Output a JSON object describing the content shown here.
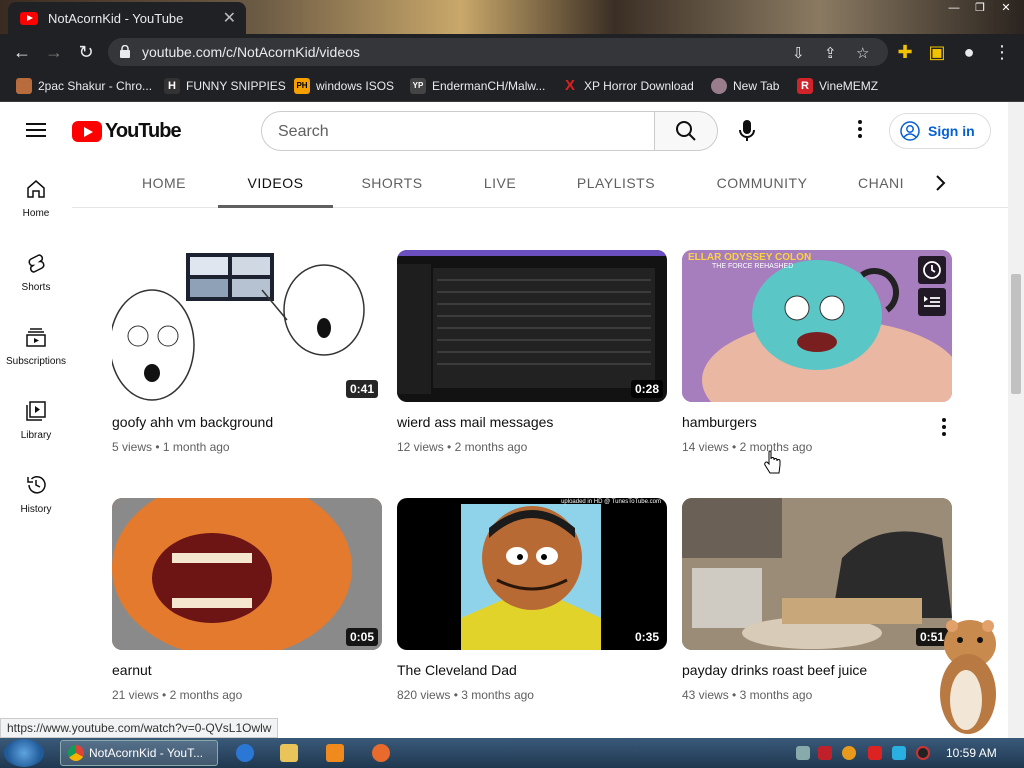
{
  "browser": {
    "tab_title": "NotAcornKid - YouTube",
    "url": "youtube.com/c/NotAcornKid/videos",
    "bookmarks": [
      {
        "label": "2pac Shakur - Chro...",
        "icon": "rapper-icon",
        "color": "#b86b3d"
      },
      {
        "label": "FUNNY SNIPPIES",
        "icon": "h-icon",
        "color": "#333333"
      },
      {
        "label": "windows ISOS",
        "icon": "ph-icon",
        "color": "#f5a000"
      },
      {
        "label": "EndermanCH/Malw...",
        "icon": "yp-icon",
        "color": "#444444"
      },
      {
        "label": "XP Horror Download",
        "icon": "x-icon",
        "color": "#e02020"
      },
      {
        "label": "New Tab",
        "icon": "globe-icon",
        "color": "#9a7d8c"
      },
      {
        "label": "VineMEMZ",
        "icon": "r-icon",
        "color": "#d0232a"
      }
    ]
  },
  "youtube": {
    "logo_text": "YouTube",
    "search_placeholder": "Search",
    "sign_in": "Sign in",
    "guide": [
      {
        "label": "Home",
        "icon": "home-icon"
      },
      {
        "label": "Shorts",
        "icon": "shorts-icon"
      },
      {
        "label": "Subscriptions",
        "icon": "subscriptions-icon"
      },
      {
        "label": "Library",
        "icon": "library-icon"
      },
      {
        "label": "History",
        "icon": "history-icon"
      }
    ],
    "tabs": [
      "HOME",
      "VIDEOS",
      "SHORTS",
      "LIVE",
      "PLAYLISTS",
      "COMMUNITY",
      "CHANI"
    ],
    "active_tab": "VIDEOS",
    "videos": [
      {
        "title": "goofy ahh vm background",
        "views": "5 views",
        "age": "1 month ago",
        "duration": "0:41"
      },
      {
        "title": "wierd ass mail messages",
        "views": "12 views",
        "age": "2 months ago",
        "duration": "0:28"
      },
      {
        "title": "hamburgers",
        "views": "14 views",
        "age": "2 months ago",
        "duration": ""
      },
      {
        "title": "earnut",
        "views": "21 views",
        "age": "2 months ago",
        "duration": "0:05"
      },
      {
        "title": "The Cleveland Dad",
        "views": "820 views",
        "age": "3 months ago",
        "duration": "0:35"
      },
      {
        "title": "payday drinks roast beef juice",
        "views": "43 views",
        "age": "3 months ago",
        "duration": "0:51"
      }
    ],
    "hover_thumb_text": "ELLAR ODYSSEY COLON",
    "hover_thumb_subtext": "THE FORCE REHASHED",
    "cleveland_caption": "uploaded in HD @ TunesToTube.com"
  },
  "status_bar_url": "https://www.youtube.com/watch?v=0-QVsL1Owlw",
  "taskbar": {
    "active_window": "NotAcornKid - YouT...",
    "clock": "10:59 AM"
  }
}
